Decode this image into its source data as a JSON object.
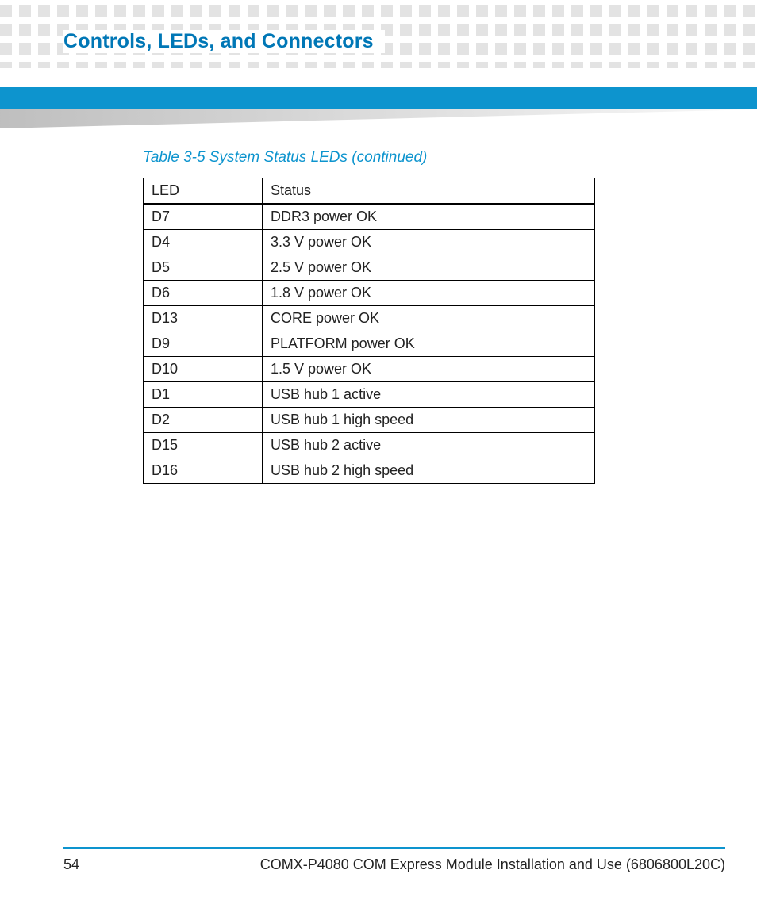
{
  "header": {
    "section_title": "Controls, LEDs, and Connectors"
  },
  "table": {
    "caption": "Table 3-5 System Status LEDs (continued)",
    "columns": [
      "LED",
      "Status"
    ],
    "rows": [
      {
        "led": "D7",
        "status": "DDR3 power OK"
      },
      {
        "led": "D4",
        "status": "3.3 V power OK"
      },
      {
        "led": "D5",
        "status": "2.5 V power OK"
      },
      {
        "led": "D6",
        "status": "1.8 V power OK"
      },
      {
        "led": "D13",
        "status": "CORE power OK"
      },
      {
        "led": "D9",
        "status": "PLATFORM power OK"
      },
      {
        "led": "D10",
        "status": "1.5 V power OK"
      },
      {
        "led": "D1",
        "status": "USB hub 1 active"
      },
      {
        "led": "D2",
        "status": "USB hub 1 high speed"
      },
      {
        "led": "D15",
        "status": "USB hub 2 active"
      },
      {
        "led": "D16",
        "status": "USB hub 2 high speed"
      }
    ]
  },
  "footer": {
    "page_number": "54",
    "doc_title": "COMX-P4080 COM Express Module Installation and Use (6806800L20C)"
  },
  "colors": {
    "brand_blue": "#0d94ce",
    "muted_square": "#e3e3e3"
  }
}
